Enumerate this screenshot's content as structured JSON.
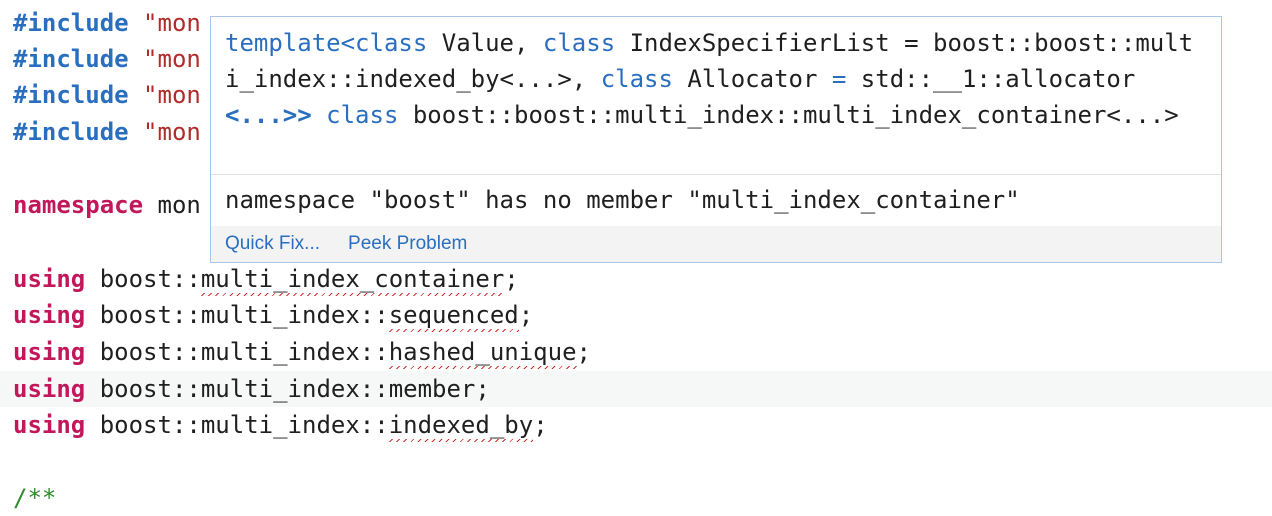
{
  "editor": {
    "includes": [
      {
        "keyword": "#include",
        "path": "\"mon"
      },
      {
        "keyword": "#include",
        "path": "\"mon"
      },
      {
        "keyword": "#include",
        "path": "\"mon"
      },
      {
        "keyword": "#include",
        "path": "\"mon"
      }
    ],
    "namespace_line": {
      "keyword": "namespace",
      "name": "mon"
    },
    "using_lines": [
      {
        "keyword": "using",
        "prefix": "boost::",
        "error_part": "multi_index_container",
        "suffix": ";",
        "error_start": "multi_index_container",
        "pre_error": ""
      },
      {
        "keyword": "using",
        "prefix": "boost::multi_index::",
        "error_part": "sequenced",
        "suffix": ";"
      },
      {
        "keyword": "using",
        "prefix": "boost::multi_index::",
        "error_part": "hashed_unique",
        "suffix": ";"
      },
      {
        "keyword": "using",
        "prefix": "boost::multi_index::",
        "error_part": "",
        "plain_part": "member",
        "suffix": ";"
      },
      {
        "keyword": "using",
        "prefix": "boost::multi_index::",
        "error_part": "indexed_by",
        "suffix": ";"
      }
    ],
    "comment_start": "/**"
  },
  "hover": {
    "signature": {
      "t1": "template",
      "p1": "<",
      "k1": "class",
      "s1": " Value, ",
      "k2": "class",
      "s2": " IndexSpecifierList = boost::boost::multi_index::indexed_by<...>, ",
      "k3": "class",
      "s3": " Allocator ",
      "eq": "=",
      "s4": " std::__1::allocator",
      "p2": "<...>>",
      "k4": "class",
      "s5": " boost::boost::multi_index::multi_index_container<...>"
    },
    "message": "namespace \"boost\" has no member \"multi_index_container\"",
    "actions": {
      "quick_fix": "Quick Fix...",
      "peek_problem": "Peek Problem"
    }
  }
}
